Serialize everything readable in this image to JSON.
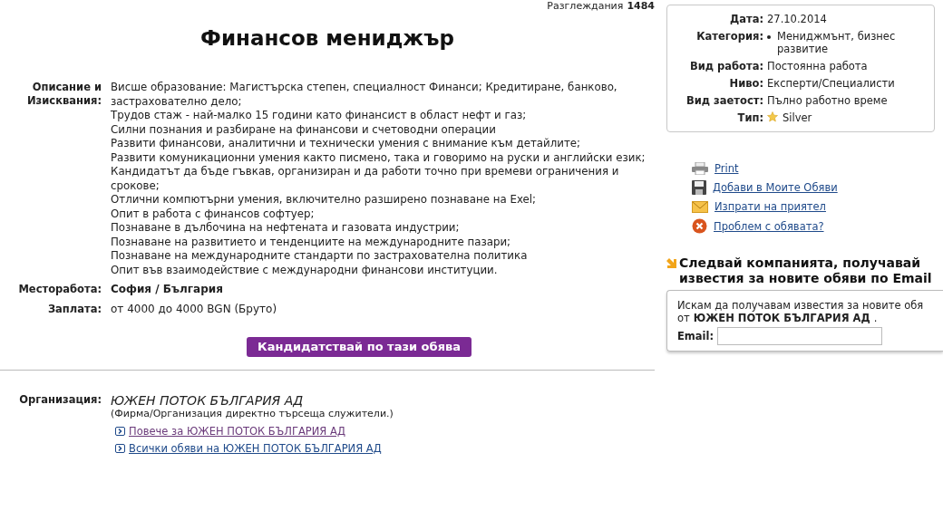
{
  "views": {
    "label": "Разглеждания",
    "count": "1484"
  },
  "title": "Финансов мениджър",
  "description": {
    "label": "Описание и Изисквания:",
    "lines": [
      "Висше образование: Магистърска степен, специалност Финанси; Кредитиране, банково, застрахователно дело;",
      "Трудов стаж - най-малко 15 години като финансист в област нефт и газ;",
      "Силни познания и разбиране на финансови и счетоводни операции",
      "Развити финансови, аналитични и технически умения с внимание към детайлите;",
      "Развити комуникационни умения както писмено, така и говоримо на руски и английски език;",
      "Кандидатът да бъде гъвкав, организиран и да работи точно при времеви ограничения и срокове;",
      "Отлични компютърни умения, включително разширено познаване на Exel;",
      "Опит в работа с финансов софтуер;",
      "Познаване в дълбочина на нефтената и газовата индустрии;",
      "Познаване на развитието и тенденциите на международните пазари;",
      "Познаване на международните стандарти по застрахователна политика",
      "Опит във взаимодействие с международни финансови институции."
    ]
  },
  "location": {
    "label": "Месторабота:",
    "value": "София / България"
  },
  "salary": {
    "label": "Заплата:",
    "value": "от 4000 до 4000 BGN (Бруто)"
  },
  "apply_button": "Кандидатствай по тази обява",
  "organization": {
    "label": "Организация:",
    "name": "ЮЖЕН ПОТОК БЪЛГАРИЯ АД",
    "note": "(Фирма/Организация директно търсеща служители.)",
    "links": [
      {
        "text": "Повече за ЮЖЕН ПОТОК БЪЛГАРИЯ АД",
        "visited": true
      },
      {
        "text": "Всички обяви на ЮЖЕН ПОТОК БЪЛГАРИЯ АД",
        "visited": false
      }
    ]
  },
  "details": [
    {
      "label": "Дата:",
      "value": "27.10.2014",
      "kind": "text"
    },
    {
      "label": "Категория:",
      "value": "Мениджмънт, бизнес развитие",
      "kind": "bullet"
    },
    {
      "label": "Вид работа:",
      "value": "Постоянна работа",
      "kind": "text"
    },
    {
      "label": "Ниво:",
      "value": "Експерти/Специалисти",
      "kind": "text"
    },
    {
      "label": "Вид заетост:",
      "value": "Пълно работно време",
      "kind": "text"
    },
    {
      "label": "Тип:",
      "value": "Silver",
      "kind": "star"
    }
  ],
  "actions": [
    {
      "text": "Print",
      "kind": "print"
    },
    {
      "text": "Добави в Моите Обяви",
      "kind": "save"
    },
    {
      "text": "Изпрати на приятел",
      "kind": "mail"
    },
    {
      "text": "Проблем с обявата?",
      "kind": "problem"
    }
  ],
  "subscribe": {
    "heading": "Следвай компанията, получавай известия за новите обяви по Email",
    "text": "Искам да получавам известия за новите обя",
    "from": "от",
    "company": "ЮЖЕН ПОТОК БЪЛГАРИЯ АД",
    "dot": ".",
    "email_label": "Email:"
  }
}
